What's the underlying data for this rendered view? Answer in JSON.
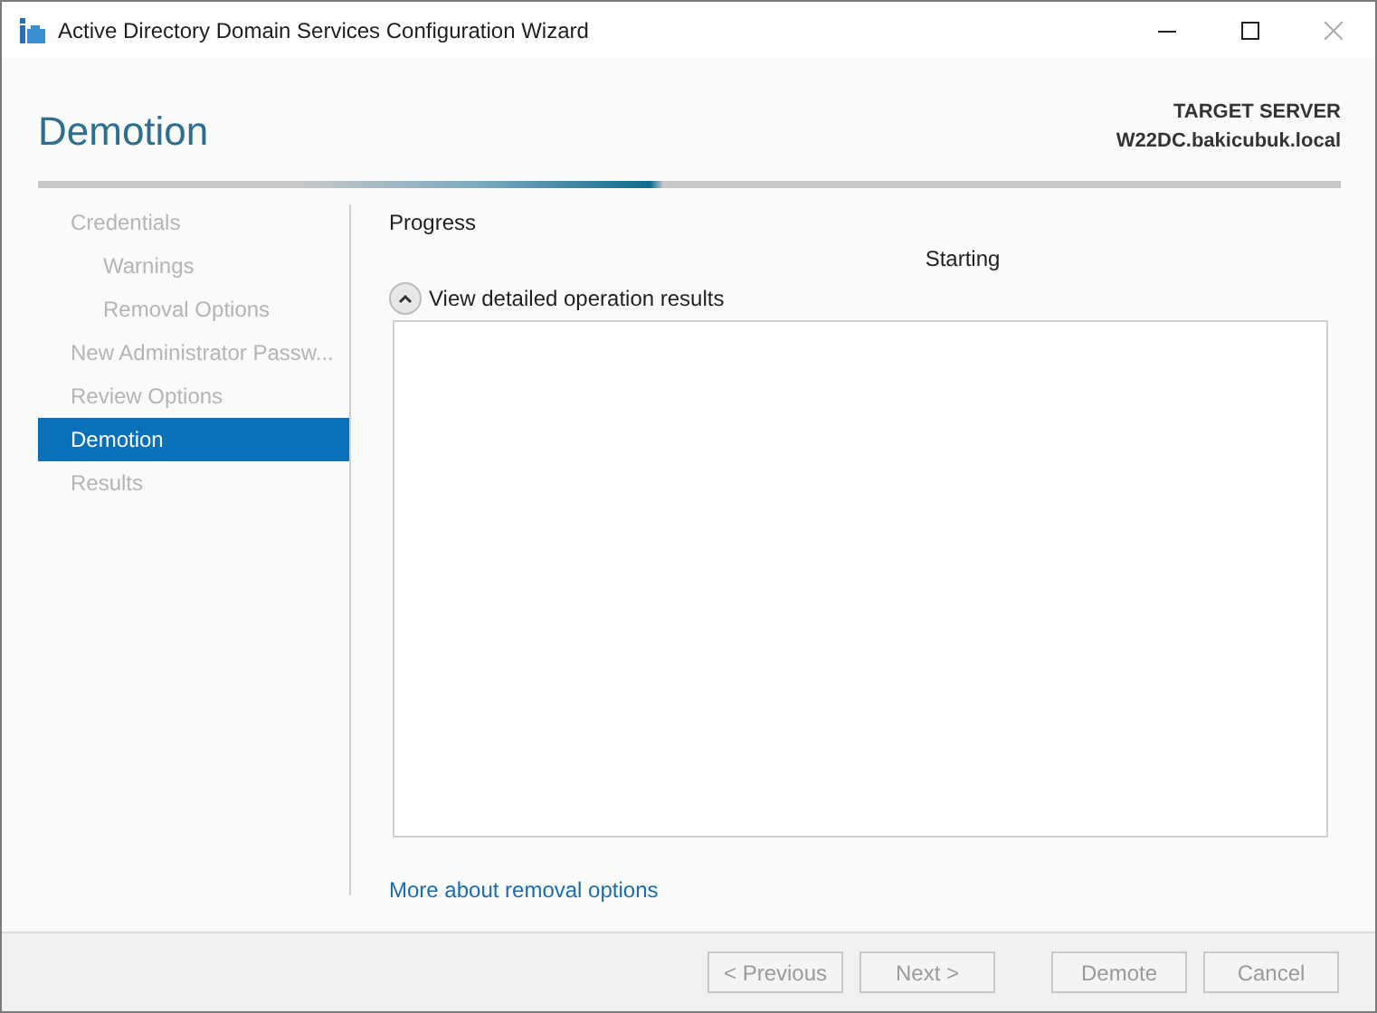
{
  "window": {
    "title": "Active Directory Domain Services Configuration Wizard"
  },
  "header": {
    "title": "Demotion",
    "target_label": "TARGET SERVER",
    "target_name": "W22DC.bakicubuk.local"
  },
  "sidebar": {
    "items": [
      {
        "label": "Credentials",
        "selected": false,
        "children": [
          {
            "label": "Warnings",
            "selected": false
          },
          {
            "label": "Removal Options",
            "selected": false
          }
        ]
      },
      {
        "label": "New Administrator Passw...",
        "selected": false
      },
      {
        "label": "Review Options",
        "selected": false
      },
      {
        "label": "Demotion",
        "selected": true
      },
      {
        "label": "Results",
        "selected": false
      }
    ]
  },
  "content": {
    "section": "Progress",
    "status": "Starting",
    "details_toggle": {
      "label": "View detailed operation results",
      "expanded": true
    },
    "link": "More about removal options"
  },
  "buttons": [
    {
      "label": "< Previous",
      "disabled": true
    },
    {
      "label": "Next >",
      "disabled": true
    },
    {
      "label": "Demote",
      "disabled": true
    },
    {
      "label": "Cancel",
      "disabled": true
    }
  ]
}
